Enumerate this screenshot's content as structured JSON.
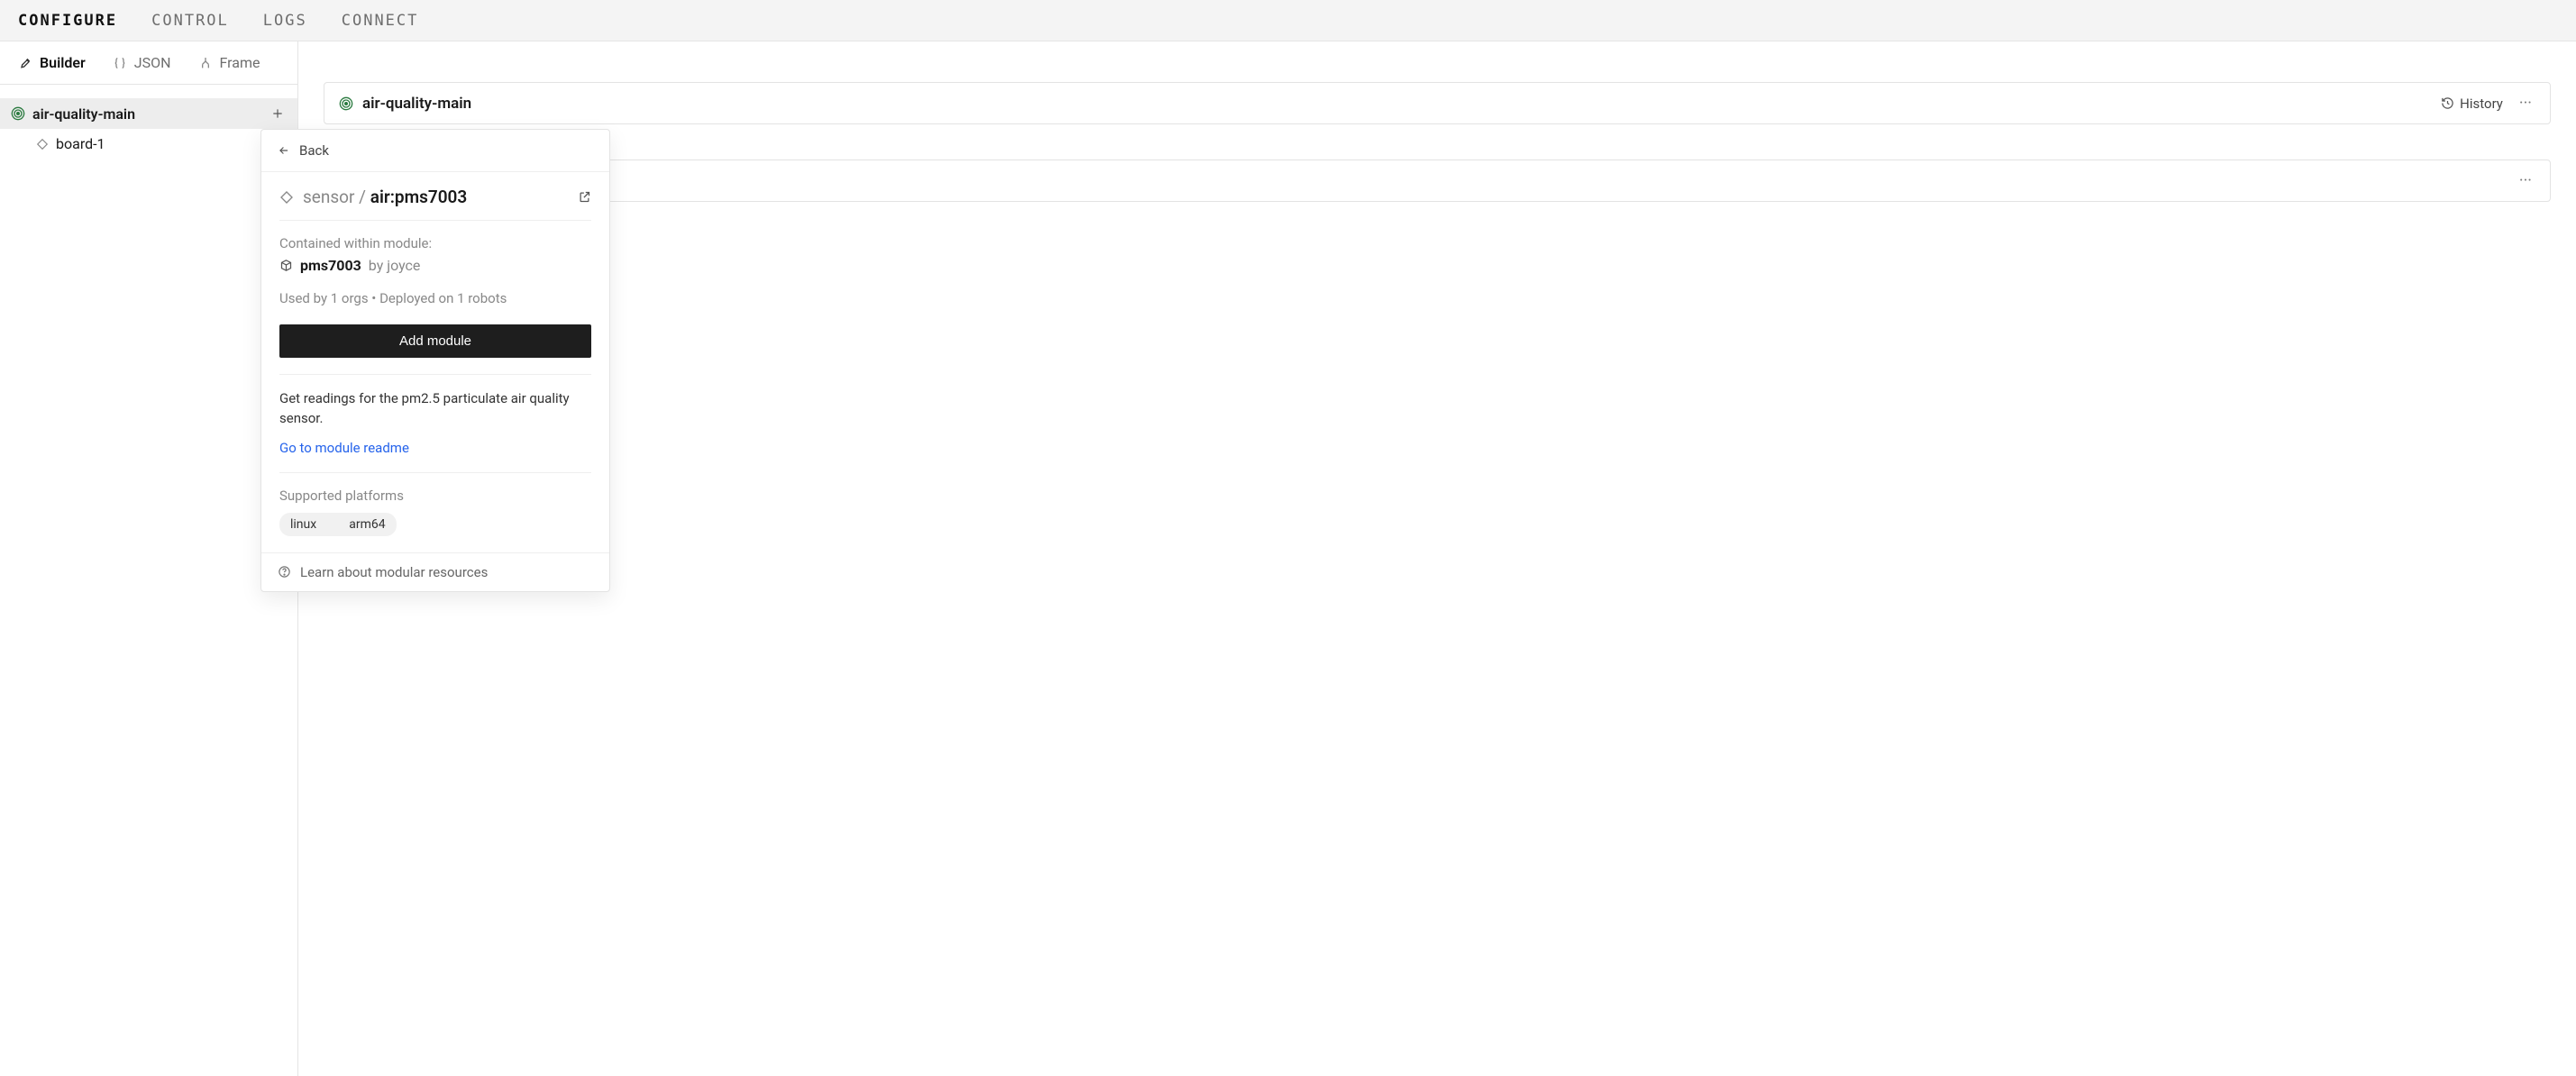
{
  "nav": {
    "items": [
      {
        "label": "CONFIGURE",
        "active": true
      },
      {
        "label": "CONTROL",
        "active": false
      },
      {
        "label": "LOGS",
        "active": false
      },
      {
        "label": "CONNECT",
        "active": false
      }
    ]
  },
  "sidebar_tabs": {
    "builder": "Builder",
    "json": "JSON",
    "frame": "Frame"
  },
  "tree": {
    "root": {
      "label": "air-quality-main"
    },
    "children": [
      {
        "label": "board-1"
      }
    ]
  },
  "main_card": {
    "title": "air-quality-main",
    "history": "History"
  },
  "popover": {
    "back": "Back",
    "breadcrumb_prefix": "sensor / ",
    "breadcrumb_name": "air:pms7003",
    "contained_label": "Contained within module:",
    "module_name": "pms7003",
    "module_by": "by joyce",
    "stats": "Used by 1 orgs  •  Deployed on 1 robots",
    "add_button": "Add module",
    "description": "Get readings for the pm2.5 particulate air quality sensor.",
    "readme_link": "Go to module readme",
    "platforms_label": "Supported platforms",
    "platform_os": "linux",
    "platform_arch": "arm64",
    "learn_link": "Learn about modular resources"
  }
}
